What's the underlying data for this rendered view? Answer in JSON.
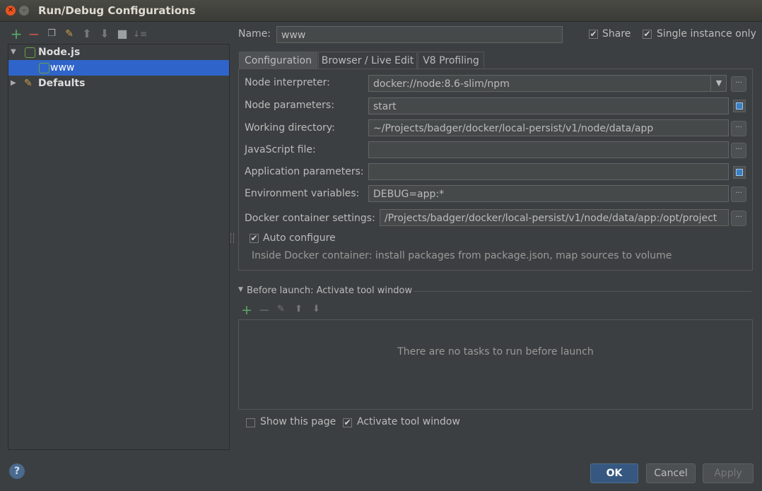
{
  "window": {
    "title": "Run/Debug Configurations"
  },
  "tree": {
    "nodejs_label": "Node.js",
    "www_label": "www",
    "defaults_label": "Defaults"
  },
  "config": {
    "name_label": "Name:",
    "name_value": "www",
    "share_label": "Share",
    "single_instance_label": "Single instance only"
  },
  "tabs": [
    "Configuration",
    "Browser / Live Edit",
    "V8 Profiling"
  ],
  "fields": {
    "node_interpreter_label": "Node interpreter:",
    "node_interpreter_value": "docker://node:8.6-slim/npm",
    "node_parameters_label": "Node parameters:",
    "node_parameters_value": "start",
    "working_directory_label": "Working directory:",
    "working_directory_value": "~/Projects/badger/docker/local-persist/v1/node/data/app",
    "javascript_file_label": "JavaScript file:",
    "javascript_file_value": "",
    "application_parameters_label": "Application parameters:",
    "application_parameters_value": "",
    "environment_variables_label": "Environment variables:",
    "environment_variables_value": "DEBUG=app:*",
    "docker_settings_label": "Docker container settings:",
    "docker_settings_value": "/Projects/badger/docker/local-persist/v1/node/data/app:/opt/project",
    "auto_configure_label": "Auto configure",
    "docker_hint": "Inside Docker container: install packages from package.json, map sources to volume"
  },
  "before_launch": {
    "title": "Before launch: Activate tool window",
    "empty_text": "There are no tasks to run before launch"
  },
  "footer": {
    "show_page_label": "Show this page",
    "activate_tool_label": "Activate tool window",
    "ok_label": "OK",
    "cancel_label": "Cancel",
    "apply_label": "Apply",
    "help_label": "?"
  },
  "colors": {
    "background": "#3c3f41",
    "selection": "#2f65ca",
    "add_green": "#59a869",
    "remove_red": "#c75450"
  }
}
